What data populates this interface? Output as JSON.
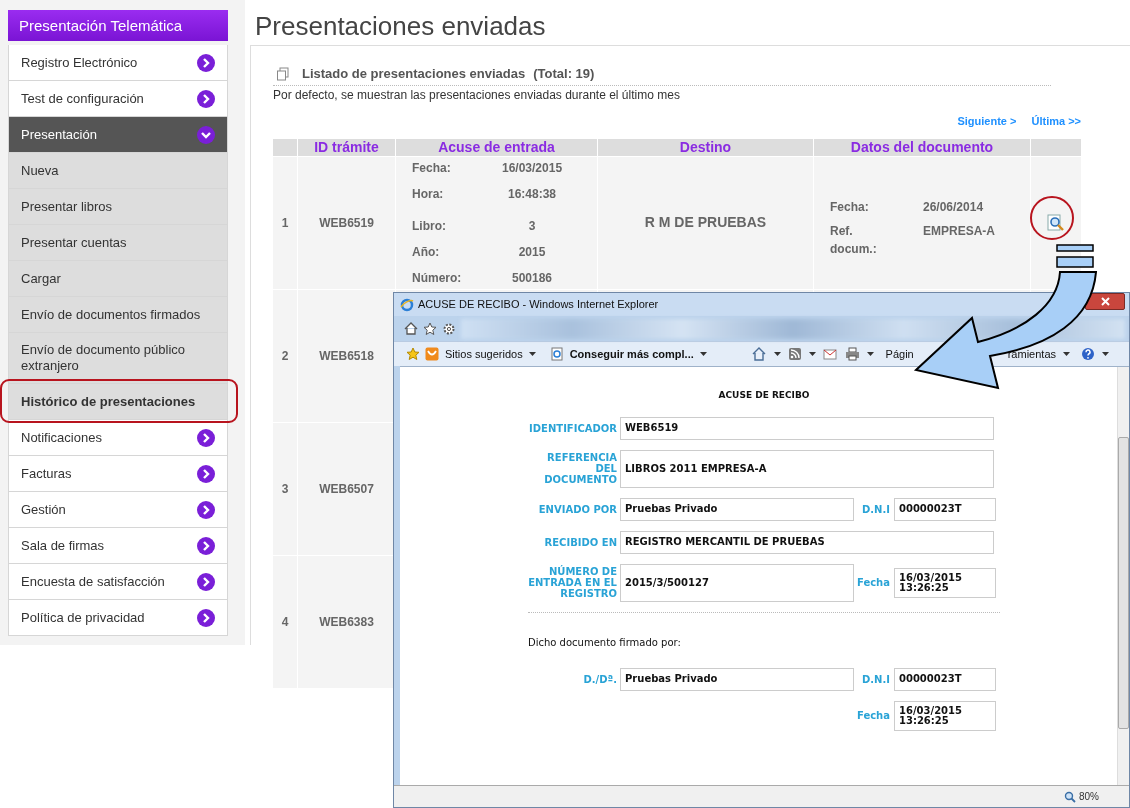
{
  "sidebar": {
    "title": "Presentación Telemática",
    "items": [
      {
        "label": "Registro Electrónico",
        "kind": "link",
        "selected": false
      },
      {
        "label": "Test de configuración",
        "kind": "link",
        "selected": false
      },
      {
        "label": "Presentación",
        "kind": "open",
        "selected": false
      },
      {
        "label": "Nueva",
        "kind": "sub",
        "selected": false
      },
      {
        "label": "Presentar libros",
        "kind": "sub",
        "selected": false
      },
      {
        "label": "Presentar cuentas",
        "kind": "sub",
        "selected": false
      },
      {
        "label": "Cargar",
        "kind": "sub",
        "selected": false
      },
      {
        "label": "Envío de documentos firmados",
        "kind": "sub",
        "selected": false
      },
      {
        "label": "Envío de documento público extranjero",
        "kind": "sub",
        "selected": false
      },
      {
        "label": "Histórico de presentaciones",
        "kind": "sub",
        "selected": true
      },
      {
        "label": "Notificaciones",
        "kind": "link",
        "selected": false
      },
      {
        "label": "Facturas",
        "kind": "link",
        "selected": false
      },
      {
        "label": "Gestión",
        "kind": "link",
        "selected": false
      },
      {
        "label": "Sala de firmas",
        "kind": "link",
        "selected": false
      },
      {
        "label": "Encuesta de satisfacción",
        "kind": "link",
        "selected": false
      },
      {
        "label": "Política de privacidad",
        "kind": "link",
        "selected": false
      }
    ]
  },
  "page": {
    "title": "Presentaciones enviadas",
    "list_title": "Listado de presentaciones enviadas",
    "total": "(Total: 19)",
    "note": "Por defecto, se muestran las presentaciones enviadas durante el último mes",
    "pagination": [
      "Siguiente >",
      "Última >>"
    ],
    "table": {
      "columns": [
        "ID trámite",
        "Acuse de entrada",
        "Destino",
        "Datos del documento"
      ],
      "rows": [
        {
          "number": "1",
          "id": "WEB6519",
          "acuse": [
            {
              "label": "Fecha:",
              "value": "16/03/2015"
            },
            {
              "label": "Hora:",
              "value": "16:48:38"
            },
            {
              "label": "Libro:",
              "value": "3"
            },
            {
              "label": "Año:",
              "value": "2015"
            },
            {
              "label": "Número:",
              "value": "500186"
            }
          ],
          "destino": "R M DE PRUEBAS",
          "datos": [
            {
              "label": "Fecha:",
              "value": "26/06/2014"
            },
            {
              "label": "Ref. docum.:",
              "value": "EMPRESA-A"
            }
          ]
        },
        {
          "number": "2",
          "id": "WEB6518"
        },
        {
          "number": "3",
          "id": "WEB6507"
        },
        {
          "number": "4",
          "id": "WEB6383"
        }
      ]
    }
  },
  "popup": {
    "title": "ACUSE DE RECIBO - Windows Internet Explorer",
    "favorites": [
      "Sitios sugeridos",
      "Conseguir más compl..."
    ],
    "command_texts": [
      "Págin",
      "ramientas"
    ],
    "document": {
      "heading": "ACUSE DE RECIBO",
      "fields": [
        {
          "label": "IDENTIFICADOR",
          "value": "WEB6519"
        },
        {
          "label": "REFERENCIA DEL DOCUMENTO",
          "value": "LIBROS 2011 EMPRESA-A"
        },
        {
          "label": "ENVIADO POR",
          "value": "Pruebas Privado",
          "extra_label": "D.N.I",
          "extra_value": "00000023T"
        },
        {
          "label": "RECIBIDO EN",
          "value": "REGISTRO MERCANTIL DE PRUEBAS"
        },
        {
          "label": "NÚMERO DE ENTRADA EN EL REGISTRO",
          "value": "2015/3/500127",
          "extra_label": "Fecha",
          "extra_value": "16/03/2015 13:26:25"
        }
      ],
      "signed_by": "Dicho documento firmado por:",
      "signer_fields": [
        {
          "label": "D./Dª.",
          "value": "Pruebas Privado",
          "extra_label": "D.N.I",
          "extra_value": "00000023T"
        },
        {
          "extra_label": "Fecha",
          "extra_value": "16/03/2015 13:26:25"
        }
      ]
    },
    "zoom": "80%"
  }
}
